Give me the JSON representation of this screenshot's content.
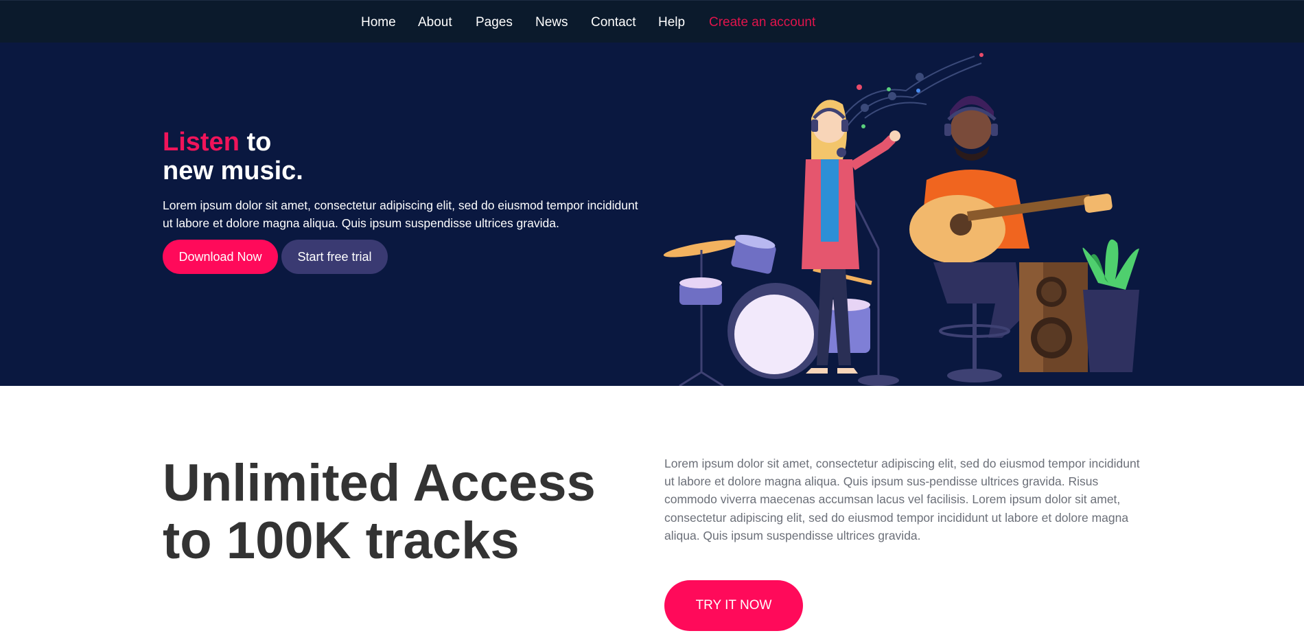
{
  "nav": {
    "items": [
      {
        "label": "Home"
      },
      {
        "label": "About"
      },
      {
        "label": "Pages"
      },
      {
        "label": "News"
      },
      {
        "label": "Contact"
      },
      {
        "label": "Help"
      }
    ],
    "cta": "Create an account"
  },
  "hero": {
    "title_highlight": "Listen",
    "title_rest_line1": " to",
    "title_line2": "new music.",
    "text": "Lorem ipsum dolor sit amet, consectetur adipiscing elit, sed do eiusmod tempor incididunt ut labore et dolore magna aliqua. Quis ipsum suspendisse ultrices gravida.",
    "download_label": "Download Now",
    "trial_label": "Start free trial"
  },
  "access": {
    "title_line1": "Unlimited Access",
    "title_line2": "to 100K tracks",
    "text": "Lorem ipsum dolor sit amet, consectetur adipiscing elit, sed do eiusmod tempor incididunt ut labore et dolore magna aliqua. Quis ipsum sus-pendisse ultrices gravida. Risus commodo viverra maecenas accumsan lacus vel facilisis. Lorem ipsum dolor sit amet, consectetur adipiscing elit, sed do eiusmod tempor incididunt ut labore et dolore magna aliqua. Quis ipsum suspendisse ultrices gravida.",
    "button_label": "TRY IT NOW"
  },
  "colors": {
    "nav_bg": "#0b1a2c",
    "hero_bg": "#0a1840",
    "accent": "#ff0a5a",
    "secondary_button": "#3a3a72",
    "heading_dark": "#333333",
    "body_gray": "#6b6f78"
  }
}
